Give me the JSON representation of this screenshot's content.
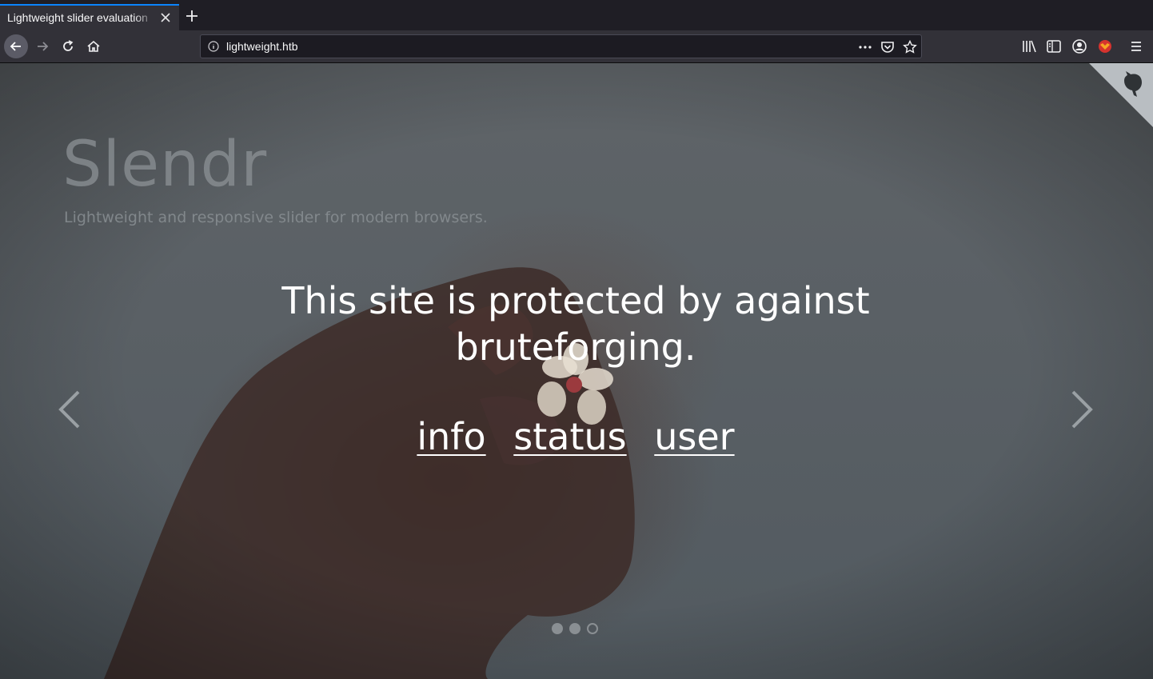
{
  "browser": {
    "tab_title": "Lightweight slider evaluation",
    "url": "lightweight.htb"
  },
  "page": {
    "brand": "Slendr",
    "tagline": "Lightweight and responsive slider for modern browsers.",
    "headline": "This site is protected by against bruteforging.",
    "links": [
      {
        "label": "info"
      },
      {
        "label": "status"
      },
      {
        "label": "user"
      }
    ],
    "slider": {
      "slide_count": 3,
      "active_index": 2
    }
  },
  "colors": {
    "tab_accent": "#0a84ff",
    "chrome_bg": "#323138",
    "text_white": "#ffffff"
  }
}
